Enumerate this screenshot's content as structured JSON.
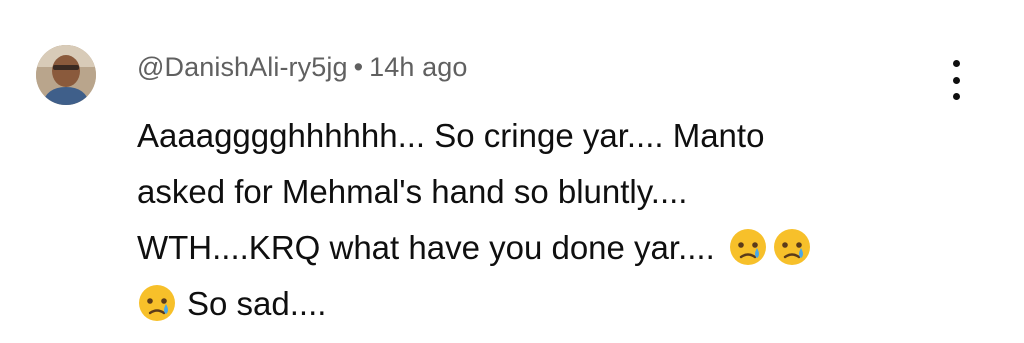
{
  "comment": {
    "author_handle": "@DanishAli-ry5jg",
    "separator": "•",
    "timestamp": "14h ago",
    "text_lines": [
      "Aaaagggghhhhhh... So cringe yar.... Manto",
      "asked for Mehmal's hand so bluntly....",
      "WTH....KRQ what have you done yar....",
      "So sad...."
    ],
    "emojis": [
      "crying-face",
      "crying-face",
      "crying-face"
    ],
    "menu_icon": "more-vertical-icon"
  }
}
